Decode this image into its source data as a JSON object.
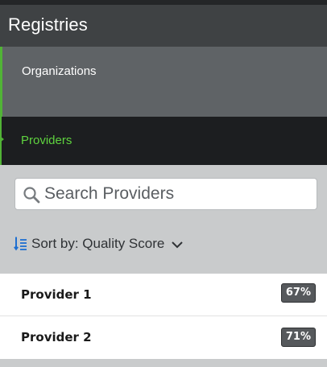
{
  "header": {
    "title": "Registries"
  },
  "nav": {
    "items": [
      {
        "label": "Organizations",
        "active": false
      },
      {
        "label": "Providers",
        "active": true
      }
    ]
  },
  "search": {
    "placeholder": "Search Providers",
    "value": "",
    "icon": "search-icon"
  },
  "sort": {
    "label": "Sort by: Quality Score",
    "icon": "sort-ascending-icon",
    "dropdown_icon": "chevron-down-icon"
  },
  "providers": [
    {
      "name": "Provider 1",
      "score": "67%"
    },
    {
      "name": "Provider 2",
      "score": "71%"
    }
  ],
  "colors": {
    "accent_green": "#51b336",
    "active_text_green": "#5fd33f",
    "sort_icon_blue": "#1e6fd0",
    "header_bg": "#3f4244",
    "nav_bg": "#5f6366",
    "active_nav_bg": "#1c1e20",
    "filter_bg": "#c9cbcc",
    "badge_bg": "#56595c"
  }
}
